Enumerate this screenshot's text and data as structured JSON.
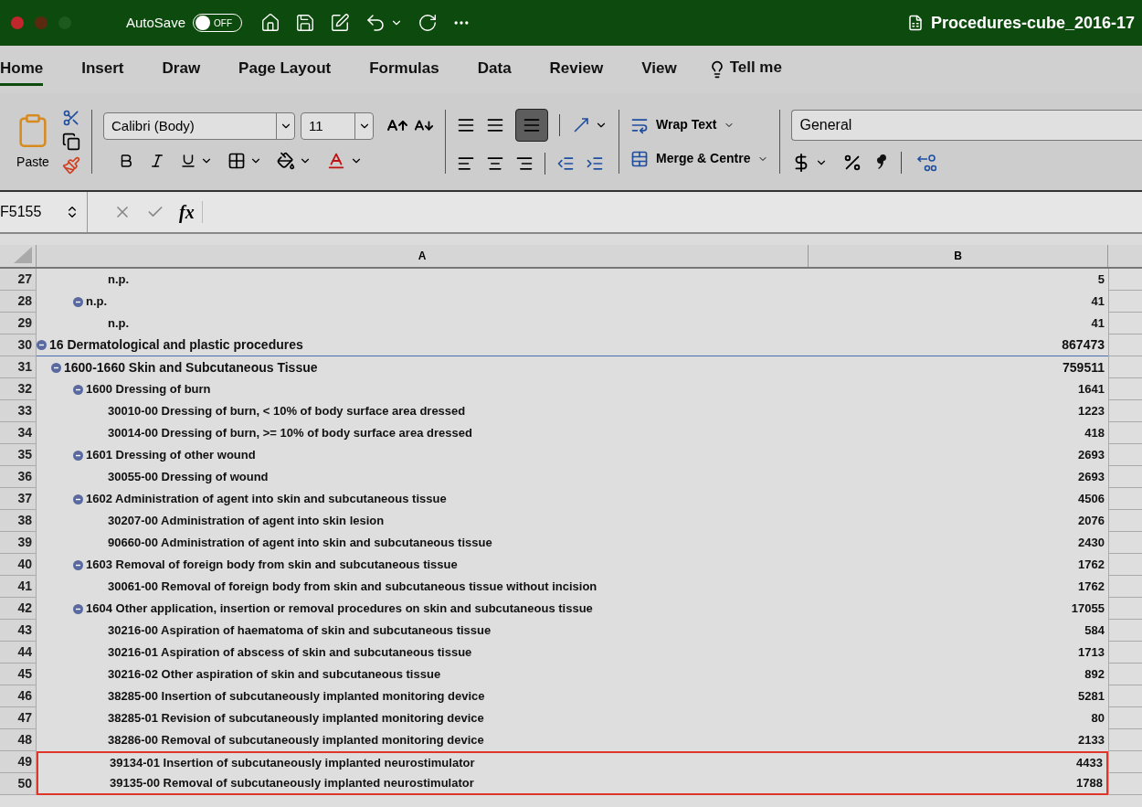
{
  "title_bar": {
    "autosave_label": "AutoSave",
    "autosave": {
      "on": false,
      "label": "OFF"
    },
    "document_title": "Procedures-cube_2016-17"
  },
  "tabs": [
    {
      "label": "Home",
      "selected": true
    },
    {
      "label": "Insert",
      "selected": false
    },
    {
      "label": "Draw",
      "selected": false
    },
    {
      "label": "Page Layout",
      "selected": false
    },
    {
      "label": "Formulas",
      "selected": false
    },
    {
      "label": "Data",
      "selected": false
    },
    {
      "label": "Review",
      "selected": false
    },
    {
      "label": "View",
      "selected": false
    }
  ],
  "tell_me": "Tell me",
  "ribbon": {
    "paste_label": "Paste",
    "font_name": "Calibri (Body)",
    "font_size": "11",
    "wrap_text": "Wrap Text",
    "merge": "Merge & Centre",
    "number_format": "General",
    "align_middle_selected": true
  },
  "formula_bar": {
    "name_box": "F5155",
    "function_label": "fx"
  },
  "columns": [
    {
      "label": "A"
    },
    {
      "label": "B"
    }
  ],
  "rows": [
    {
      "kind": "continuation",
      "children": [
        {
          "kind": "continuation",
          "children": [
            {
              "kind": "continuation",
              "children": [
                {
                  "number": "27",
                  "label": "n.p.",
                  "value": "5"
                }
              ]
            },
            {
              "number": "28",
              "label": "n.p.",
              "value": "41",
              "expanded": true,
              "children": [
                {
                  "number": "29",
                  "label": "n.p.",
                  "value": "41"
                }
              ]
            }
          ]
        }
      ]
    },
    {
      "number": "30",
      "label": "16 Dermatological and plastic procedures",
      "value": "867473",
      "emphasis": true,
      "border_below": true,
      "expanded": true,
      "children": [
        {
          "number": "31",
          "label": "1600-1660 Skin and Subcutaneous Tissue",
          "value": "759511",
          "emphasis": true,
          "expanded": true,
          "children": [
            {
              "number": "32",
              "label": "1600 Dressing of burn",
              "value": "1641",
              "expanded": true,
              "children": [
                {
                  "number": "33",
                  "label": "30010-00 Dressing of burn, < 10% of body surface area dressed",
                  "value": "1223"
                },
                {
                  "number": "34",
                  "label": "30014-00 Dressing of burn, >= 10% of body surface area dressed",
                  "value": "418"
                }
              ]
            },
            {
              "number": "35",
              "label": "1601 Dressing of other wound",
              "value": "2693",
              "expanded": true,
              "children": [
                {
                  "number": "36",
                  "label": "30055-00 Dressing of wound",
                  "value": "2693"
                }
              ]
            },
            {
              "number": "37",
              "label": "1602 Administration of agent into skin and subcutaneous tissue",
              "value": "4506",
              "expanded": true,
              "children": [
                {
                  "number": "38",
                  "label": "30207-00 Administration of agent into skin lesion",
                  "value": "2076"
                },
                {
                  "number": "39",
                  "label": "90660-00 Administration of agent into skin and subcutaneous tissue",
                  "value": "2430"
                }
              ]
            },
            {
              "number": "40",
              "label": "1603 Removal of foreign body from skin and subcutaneous tissue",
              "value": "1762",
              "expanded": true,
              "children": [
                {
                  "number": "41",
                  "label": "30061-00 Removal of foreign body from skin and subcutaneous tissue without incision",
                  "value": "1762"
                }
              ]
            },
            {
              "number": "42",
              "label": "1604 Other application, insertion or removal procedures on skin and subcutaneous tissue",
              "value": "17055",
              "expanded": true,
              "children": [
                {
                  "number": "43",
                  "label": "30216-00 Aspiration of haematoma of skin and subcutaneous tissue",
                  "value": "584"
                },
                {
                  "number": "44",
                  "label": "30216-01 Aspiration of abscess of skin and subcutaneous tissue",
                  "value": "1713"
                },
                {
                  "number": "45",
                  "label": "30216-02 Other aspiration of skin and subcutaneous tissue",
                  "value": "892"
                },
                {
                  "number": "46",
                  "label": "38285-00 Insertion of subcutaneously implanted monitoring device",
                  "value": "5281"
                },
                {
                  "number": "47",
                  "label": "38285-01 Revision of subcutaneously implanted monitoring device",
                  "value": "80"
                },
                {
                  "number": "48",
                  "label": "38286-00 Removal of subcutaneously implanted monitoring device",
                  "value": "2133"
                },
                {
                  "number": "49",
                  "label": "39134-01 Insertion of subcutaneously implanted neurostimulator",
                  "value": "4433",
                  "highlighted": true
                },
                {
                  "number": "50",
                  "label": "39135-00 Removal of subcutaneously implanted neurostimulator",
                  "value": "1788",
                  "highlighted": true
                }
              ]
            }
          ]
        }
      ]
    }
  ]
}
